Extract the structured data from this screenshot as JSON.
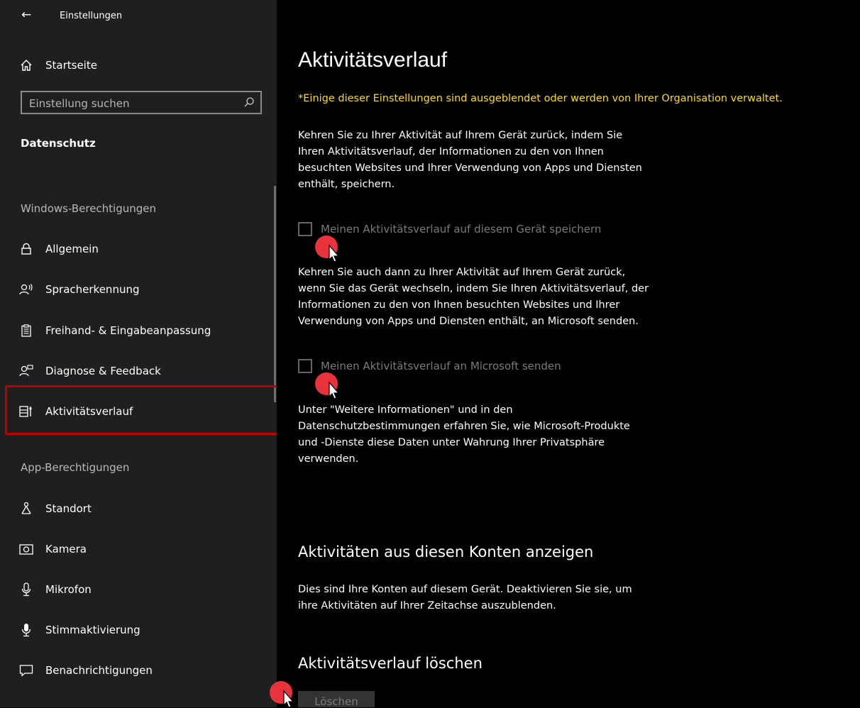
{
  "window": {
    "back_icon": "back-arrow-icon",
    "title": "Einstellungen"
  },
  "sidebar": {
    "home": {
      "icon": "home-icon",
      "label": "Startseite"
    },
    "search": {
      "placeholder": "Einstellung suchen",
      "icon": "search-icon"
    },
    "group_title": "Datenschutz",
    "windows_permissions_header": "Windows-Berechtigungen",
    "windows_items": [
      {
        "icon": "lock-icon",
        "label": "Allgemein"
      },
      {
        "icon": "speech-icon",
        "label": "Spracherkennung"
      },
      {
        "icon": "clipboard-icon",
        "label": "Freihand- & Eingabeanpassung"
      },
      {
        "icon": "feedback-icon",
        "label": "Diagnose & Feedback"
      },
      {
        "icon": "timeline-icon",
        "label": "Aktivitätsverlauf",
        "selected": true
      }
    ],
    "app_permissions_header": "App-Berechtigungen",
    "app_items": [
      {
        "icon": "location-icon",
        "label": "Standort"
      },
      {
        "icon": "camera-icon",
        "label": "Kamera"
      },
      {
        "icon": "microphone-icon",
        "label": "Mikrofon"
      },
      {
        "icon": "voice-activation-icon",
        "label": "Stimmaktivierung"
      },
      {
        "icon": "notification-icon",
        "label": "Benachrichtigungen"
      }
    ],
    "selection_color": "#c00000"
  },
  "main": {
    "title": "Aktivitätsverlauf",
    "org_notice": "*Einige dieser Einstellungen sind ausgeblendet oder werden von Ihrer Organisation verwaltet.",
    "org_notice_color": "#ffdd00",
    "intro_lines": [
      "Kehren Sie zu Ihrer Aktivität auf Ihrem Gerät zurück, indem Sie",
      "Ihren Aktivitätsverlauf, der Informationen zu den von Ihnen",
      "besuchten Websites und Ihrer Verwendung von Apps und Diensten",
      "enthält, speichern."
    ],
    "checkbox_store": {
      "label": "Meinen Aktivitätsverlauf auf diesem Gerät speichern",
      "checked": false,
      "disabled": true
    },
    "send_lines": [
      "Kehren Sie auch dann zu Ihrer Aktivität auf Ihrem Gerät zurück,",
      "wenn Sie das Gerät wechseln, indem Sie Ihren Aktivitätsverlauf, der",
      "Informationen zu den von Ihnen besuchten Websites und Ihrer",
      "Verwendung von Apps und Diensten enthält, an Microsoft senden."
    ],
    "checkbox_send": {
      "label": "Meinen Aktivitätsverlauf an Microsoft senden",
      "checked": false,
      "disabled": true
    },
    "privacy_lines": [
      "Unter \"Weitere Informationen\" und in den",
      "Datenschutzbestimmungen erfahren Sie, wie Microsoft-Produkte",
      "und -Dienste diese Daten unter Wahrung Ihrer Privatsphäre",
      "verwenden."
    ],
    "accounts_heading": "Aktivitäten aus diesen Konten anzeigen",
    "accounts_lines": [
      "Dies sind Ihre Konten auf diesem Gerät. Deaktivieren Sie sie, um",
      "ihre Aktivitäten auf Ihrer Zeitachse auszublenden."
    ],
    "clear_heading": "Aktivitätsverlauf löschen",
    "clear_button": "Löschen"
  }
}
